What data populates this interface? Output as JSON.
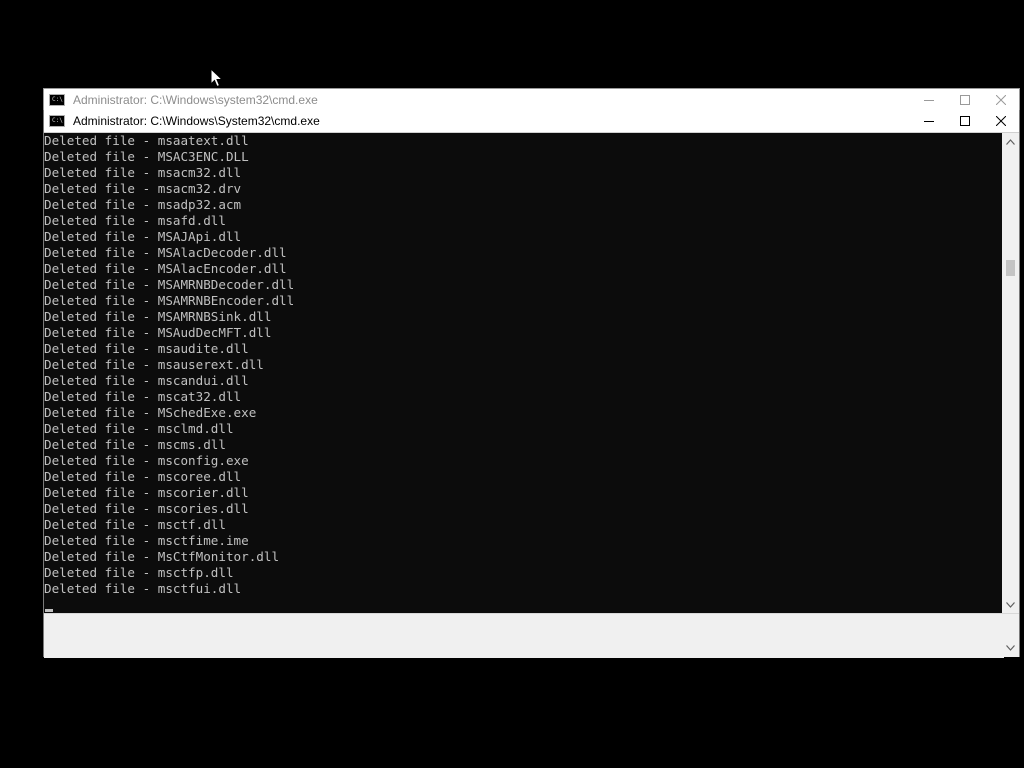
{
  "background_window": {
    "title": "Administrator: C:\\Windows\\system32\\cmd.exe"
  },
  "active_window": {
    "title": "Administrator:  C:\\Windows\\System32\\cmd.exe"
  },
  "console": {
    "lines": [
      "Deleted file - msaatext.dll",
      "Deleted file - MSAC3ENC.DLL",
      "Deleted file - msacm32.dll",
      "Deleted file - msacm32.drv",
      "Deleted file - msadp32.acm",
      "Deleted file - msafd.dll",
      "Deleted file - MSAJApi.dll",
      "Deleted file - MSAlacDecoder.dll",
      "Deleted file - MSAlacEncoder.dll",
      "Deleted file - MSAMRNBDecoder.dll",
      "Deleted file - MSAMRNBEncoder.dll",
      "Deleted file - MSAMRNBSink.dll",
      "Deleted file - MSAudDecMFT.dll",
      "Deleted file - msaudite.dll",
      "Deleted file - msauserext.dll",
      "Deleted file - mscandui.dll",
      "Deleted file - mscat32.dll",
      "Deleted file - MSchedExe.exe",
      "Deleted file - msclmd.dll",
      "Deleted file - mscms.dll",
      "Deleted file - msconfig.exe",
      "Deleted file - mscoree.dll",
      "Deleted file - mscorier.dll",
      "Deleted file - mscories.dll",
      "Deleted file - msctf.dll",
      "Deleted file - msctfime.ime",
      "Deleted file - MsCtfMonitor.dll",
      "Deleted file - msctfp.dll",
      "Deleted file - msctfui.dll"
    ]
  },
  "icons": {
    "window": "cmd-icon",
    "minimize": "minimize-icon",
    "maximize": "maximize-icon",
    "close": "close-icon",
    "scroll_up": "chevron-up-icon",
    "scroll_down": "chevron-down-icon",
    "mouse": "mouse-pointer-icon"
  },
  "colors": {
    "console_bg": "#0c0c0c",
    "console_text": "#c0c0c0",
    "desktop_bg": "#000000"
  }
}
